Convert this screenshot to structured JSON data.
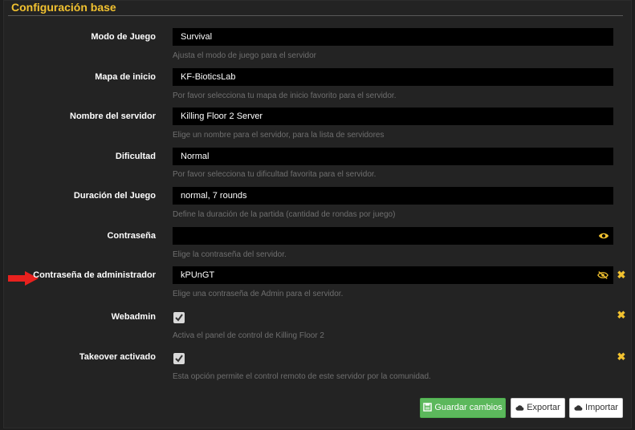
{
  "section": {
    "title": "Configuración base"
  },
  "fields": [
    {
      "label": "Modo de Juego",
      "value": "Survival",
      "help": "Ajusta el modo de juego para el servidor"
    },
    {
      "label": "Mapa de inicio",
      "value": "KF-BioticsLab",
      "help": "Por favor selecciona tu mapa de inicio favorito para el servidor."
    },
    {
      "label": "Nombre del servidor",
      "value": "Killing Floor 2 Server",
      "help": "Elige un nombre para el servidor, para la lista de servidores"
    },
    {
      "label": "Dificultad",
      "value": "Normal",
      "help": "Por favor selecciona tu dificultad favorita para el servidor."
    },
    {
      "label": "Duración del Juego",
      "value": "normal, 7 rounds",
      "help": "Define la duración de la partida (cantidad de rondas por juego)"
    },
    {
      "label": "Contraseña",
      "value": "",
      "help": "Elige la contraseña del servidor."
    },
    {
      "label": "Contraseña de administrador",
      "value": "kPUnGT",
      "help": "Elige una contraseña de Admin para el servidor."
    }
  ],
  "checkboxes": [
    {
      "label": "Webadmin",
      "checked": true,
      "help": "Activa el panel de control de Killing Floor 2"
    },
    {
      "label": "Takeover activado",
      "checked": true,
      "help": "Esta opción permite el control remoto de este servidor por la comunidad."
    }
  ],
  "buttons": {
    "save": "Guardar cambios",
    "export": "Exportar",
    "import": "Importar"
  },
  "colors": {
    "accent": "#f2c230",
    "save": "#5cb85c",
    "arrow": "#e8211e",
    "background": "#232323",
    "field": "#000000"
  },
  "icons": {
    "show_password": "eye-icon",
    "hide_password": "eye-slash-icon",
    "reset": "close-icon",
    "save": "save-icon",
    "cloud": "cloud-icon",
    "annotation": "red-arrow-icon"
  }
}
